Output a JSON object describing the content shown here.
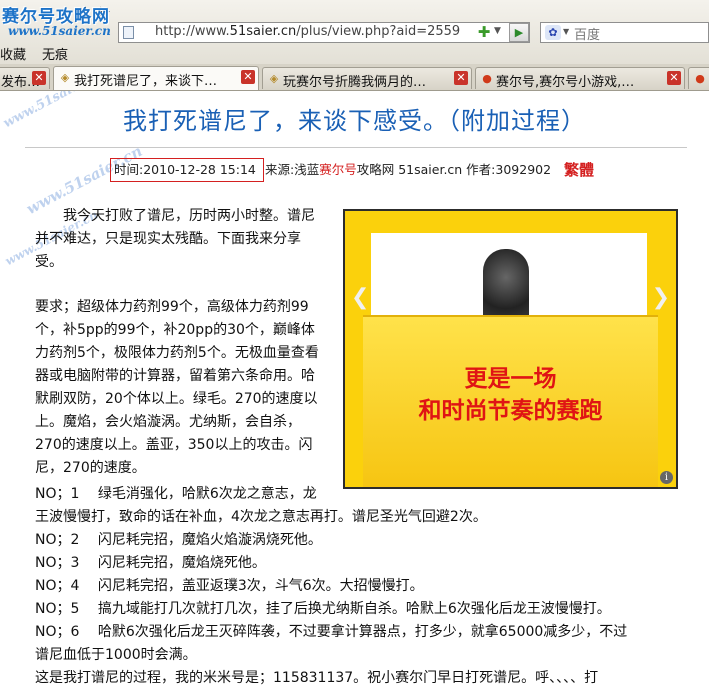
{
  "browser": {
    "logo_text": "赛尔号攻略网",
    "logo_url": "www.51saier.cn",
    "address_url_prefix": "http://www.",
    "address_url_domain": "51saier.cn",
    "address_url_path": "/plus/view.php?aid=2559",
    "search_placeholder": "百度",
    "menu": [
      "收藏",
      "无痕"
    ]
  },
  "tabs": [
    {
      "label": "发布…"
    },
    {
      "label": "我打死谱尼了，来谈下…",
      "active": true
    },
    {
      "label": "玩赛尔号折腾我俩月的…"
    },
    {
      "label": "赛尔号,赛尔号小游戏,…"
    }
  ],
  "article": {
    "title": "我打死谱尼了，来谈下感受。（附加过程）",
    "meta_time": "时间:2010-12-28 15:14",
    "meta_source_prefix": "来源:浅蓝",
    "meta_source_red": "赛尔号",
    "meta_source_suffix": "攻略网 51saier.cn 作者:3092902",
    "traditional_link": "繁體",
    "intro_lines": [
      "我今天打败了谱尼，历时两小时整。谱尼",
      "并不难达，只是现实太残酷。下面我来分享",
      "受。"
    ],
    "req_lines": [
      "要求；超级体力药剂99个，高级体力药剂99",
      "个，补5pp的99个，补20pp的30个，巅峰体",
      "力药剂5个，极限体力药剂5个。无极血量查看",
      "器或电脑附带的计算器，留着第六条命用。哈",
      "默刷双防，20个体以上。绿毛。270的速度以",
      "上。魔焰，会火焰漩涡。尤纳斯，会自杀，",
      "270的速度以上。盖亚，350以上的攻击。闪",
      "尼，270的速度。"
    ],
    "steps": [
      "NO；1　 绿毛消强化，哈默6次龙之意志，龙",
      "王波慢慢打，致命的话在补血，4次龙之意志再打。谱尼圣光气回避2次。",
      "NO；2　 闪尼耗完招，魔焰火焰漩涡烧死他。",
      "NO；3　 闪尼耗完招，魔焰烧死他。",
      "NO；4　 闪尼耗完招，盖亚返璞3次，斗气6次。大招慢慢打。",
      "NO；5　 搞九域能打几次就打几次，挂了后换尤纳斯自杀。哈默上6次强化后龙王波慢慢打。",
      "NO；6　 哈默6次强化后龙王灭碎阵袭，不过要拿计算器点，打多少，就拿65000减多少，不过",
      "谱尼血低于1000时会满。",
      "这是我打谱尼的过程，我的米米号是；115831137。祝小赛尔门早日打死谱尼。呼、、、、打"
    ]
  },
  "ad": {
    "line1": "更是一场",
    "line2": "和时尚节奏的赛跑",
    "info": "i"
  },
  "colors": {
    "title_blue": "#1a60b5",
    "accent_red": "#d42020",
    "ad_yellow": "#fbd10c"
  }
}
